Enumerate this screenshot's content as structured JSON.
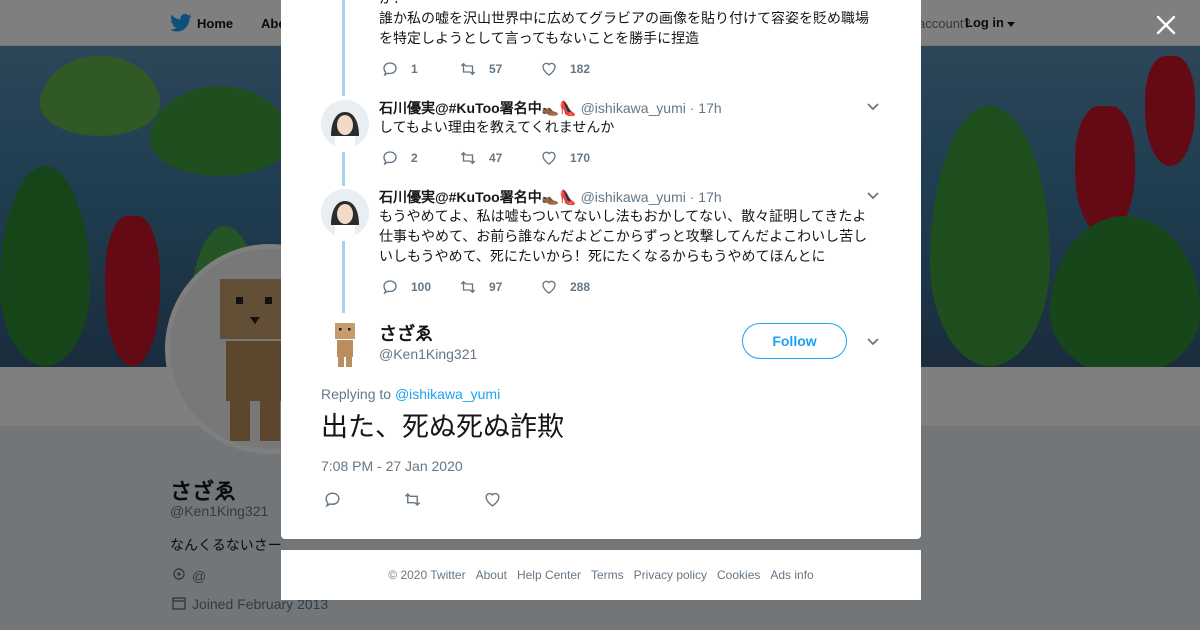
{
  "nav": {
    "home_label": "Home",
    "about_label": "Abo",
    "account_prompt": "account?",
    "login_label": "Log in"
  },
  "profile": {
    "name": "さざゑ",
    "handle": "@Ken1King321",
    "bio": "なんくるないさー",
    "location": "@",
    "joined": "Joined February 2013"
  },
  "thread": {
    "top_fragment": {
      "text": "か？\n誰か私の嘘を沢山世界中に広めてグラビアの画像を貼り付けて容姿を貶め職場を特定しようとして言ってもないことを勝手に捏造",
      "replies": "1",
      "retweets": "57",
      "likes": "182"
    },
    "replies": [
      {
        "name": "石川優実@#KuToo署名中👞👠",
        "handle": "@ishikawa_yumi",
        "time": "· 17h",
        "text": "してもよい理由を教えてくれませんか",
        "replies": "2",
        "retweets": "47",
        "likes": "170"
      },
      {
        "name": "石川優実@#KuToo署名中👞👠",
        "handle": "@ishikawa_yumi",
        "time": "· 17h",
        "text": "もうやめてよ、私は嘘もついてないし法もおかしてない、散々証明してきたよ仕事もやめて、お前ら誰なんだよどこからずっと攻撃してんだよこわいし苦しいしもうやめて、死にたいから！死にたくなるからもうやめてほんとに",
        "replies": "100",
        "retweets": "97",
        "likes": "288"
      }
    ]
  },
  "focused_tweet": {
    "name": "さざゑ",
    "handle": "@Ken1King321",
    "follow_label": "Follow",
    "replying_prefix": "Replying to",
    "replying_to": "@ishikawa_yumi",
    "text": "出た、死ぬ死ぬ詐欺",
    "timestamp": "7:08 PM - 27 Jan 2020"
  },
  "footer": {
    "links": [
      "© 2020 Twitter",
      "About",
      "Help Center",
      "Terms",
      "Privacy policy",
      "Cookies",
      "Ads info"
    ]
  },
  "colors": {
    "accent": "#1da1f2",
    "thread_line": "#a8d1ef",
    "muted_text": "#657786"
  }
}
